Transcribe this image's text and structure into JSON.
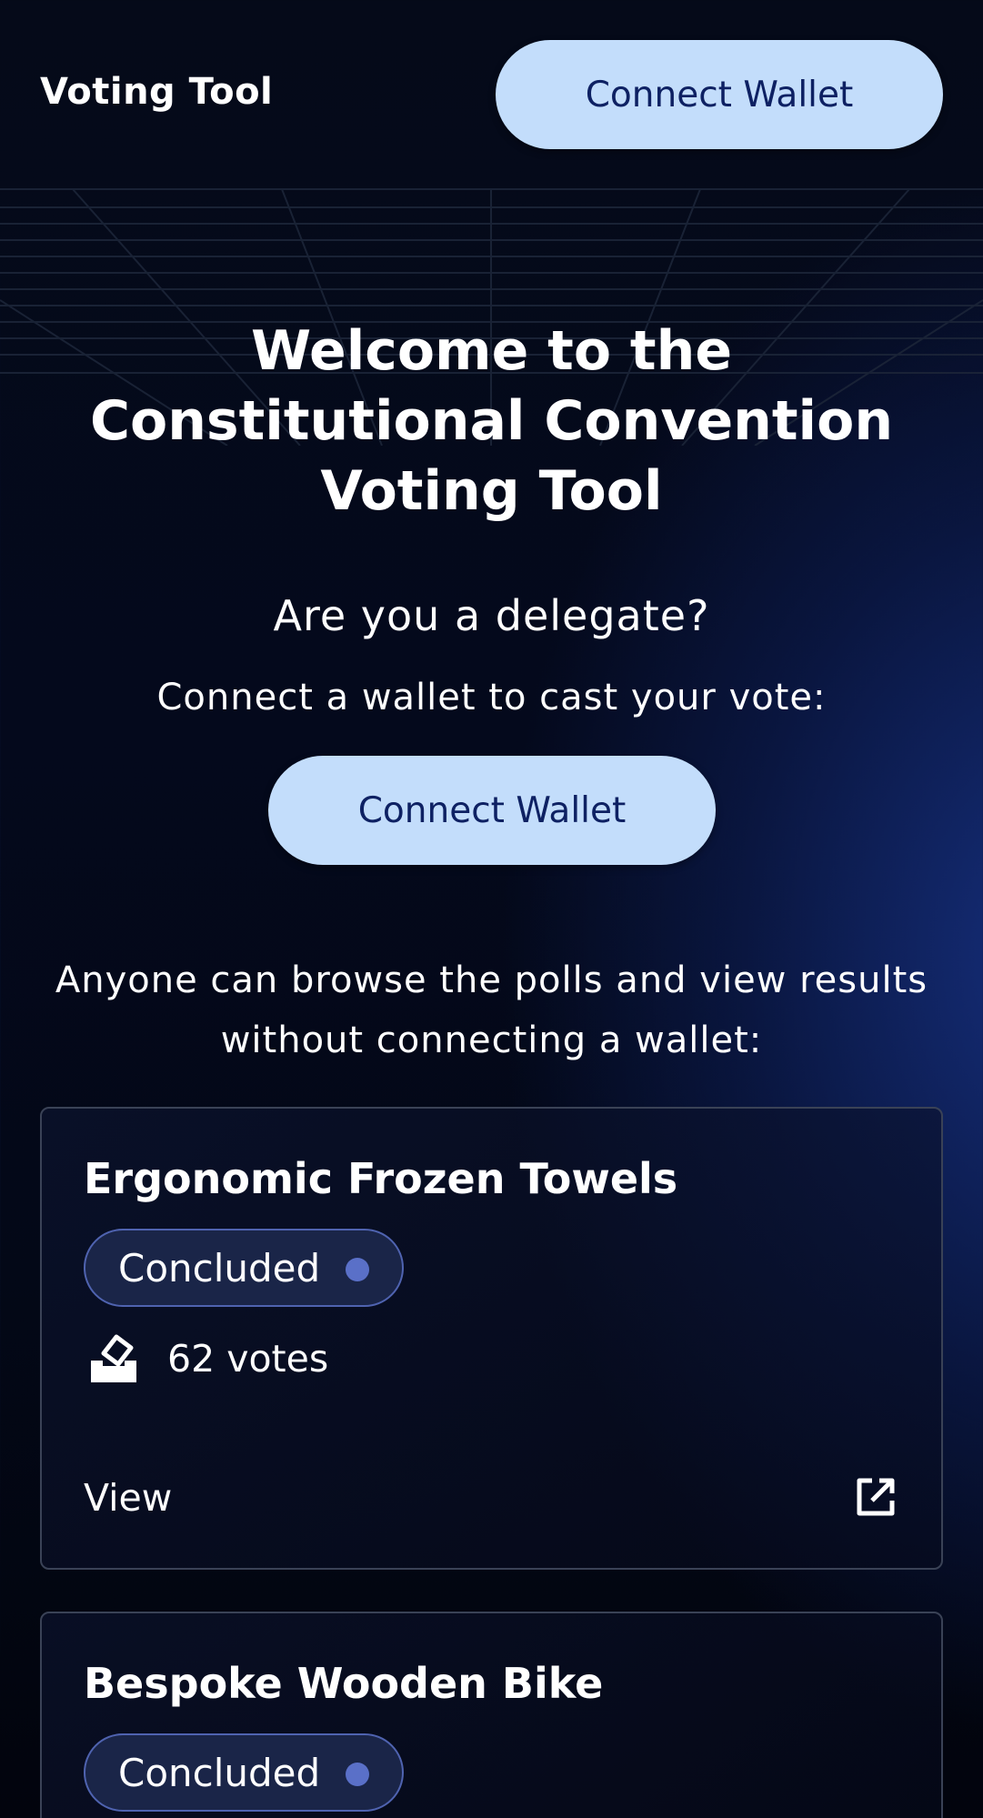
{
  "header": {
    "brand": "Voting Tool",
    "connect_label": "Connect Wallet"
  },
  "hero": {
    "title_line1": "Welcome to the",
    "title_line2": "Constitutional Convention",
    "title_line3": "Voting Tool",
    "delegate_question": "Are you a delegate?",
    "connect_prompt": "Connect a wallet to cast your vote:",
    "connect_label": "Connect Wallet",
    "browse_line1": "Anyone can browse the polls and view results",
    "browse_line2": "without connecting a wallet:"
  },
  "polls": [
    {
      "title": "Ergonomic Frozen Towels",
      "status": "Concluded",
      "votes": "62 votes",
      "view_label": "View"
    },
    {
      "title": "Bespoke Wooden Bike",
      "status": "Concluded"
    }
  ],
  "colors": {
    "accent_button": "#c3ddfb",
    "button_text": "#0e2163",
    "badge_border": "#4f63b0",
    "badge_dot": "#5a70c8",
    "card_border": "#3a4256"
  },
  "icons": {
    "votes": "ballot-box-icon",
    "view": "external-link-icon",
    "status": "status-dot-icon"
  }
}
